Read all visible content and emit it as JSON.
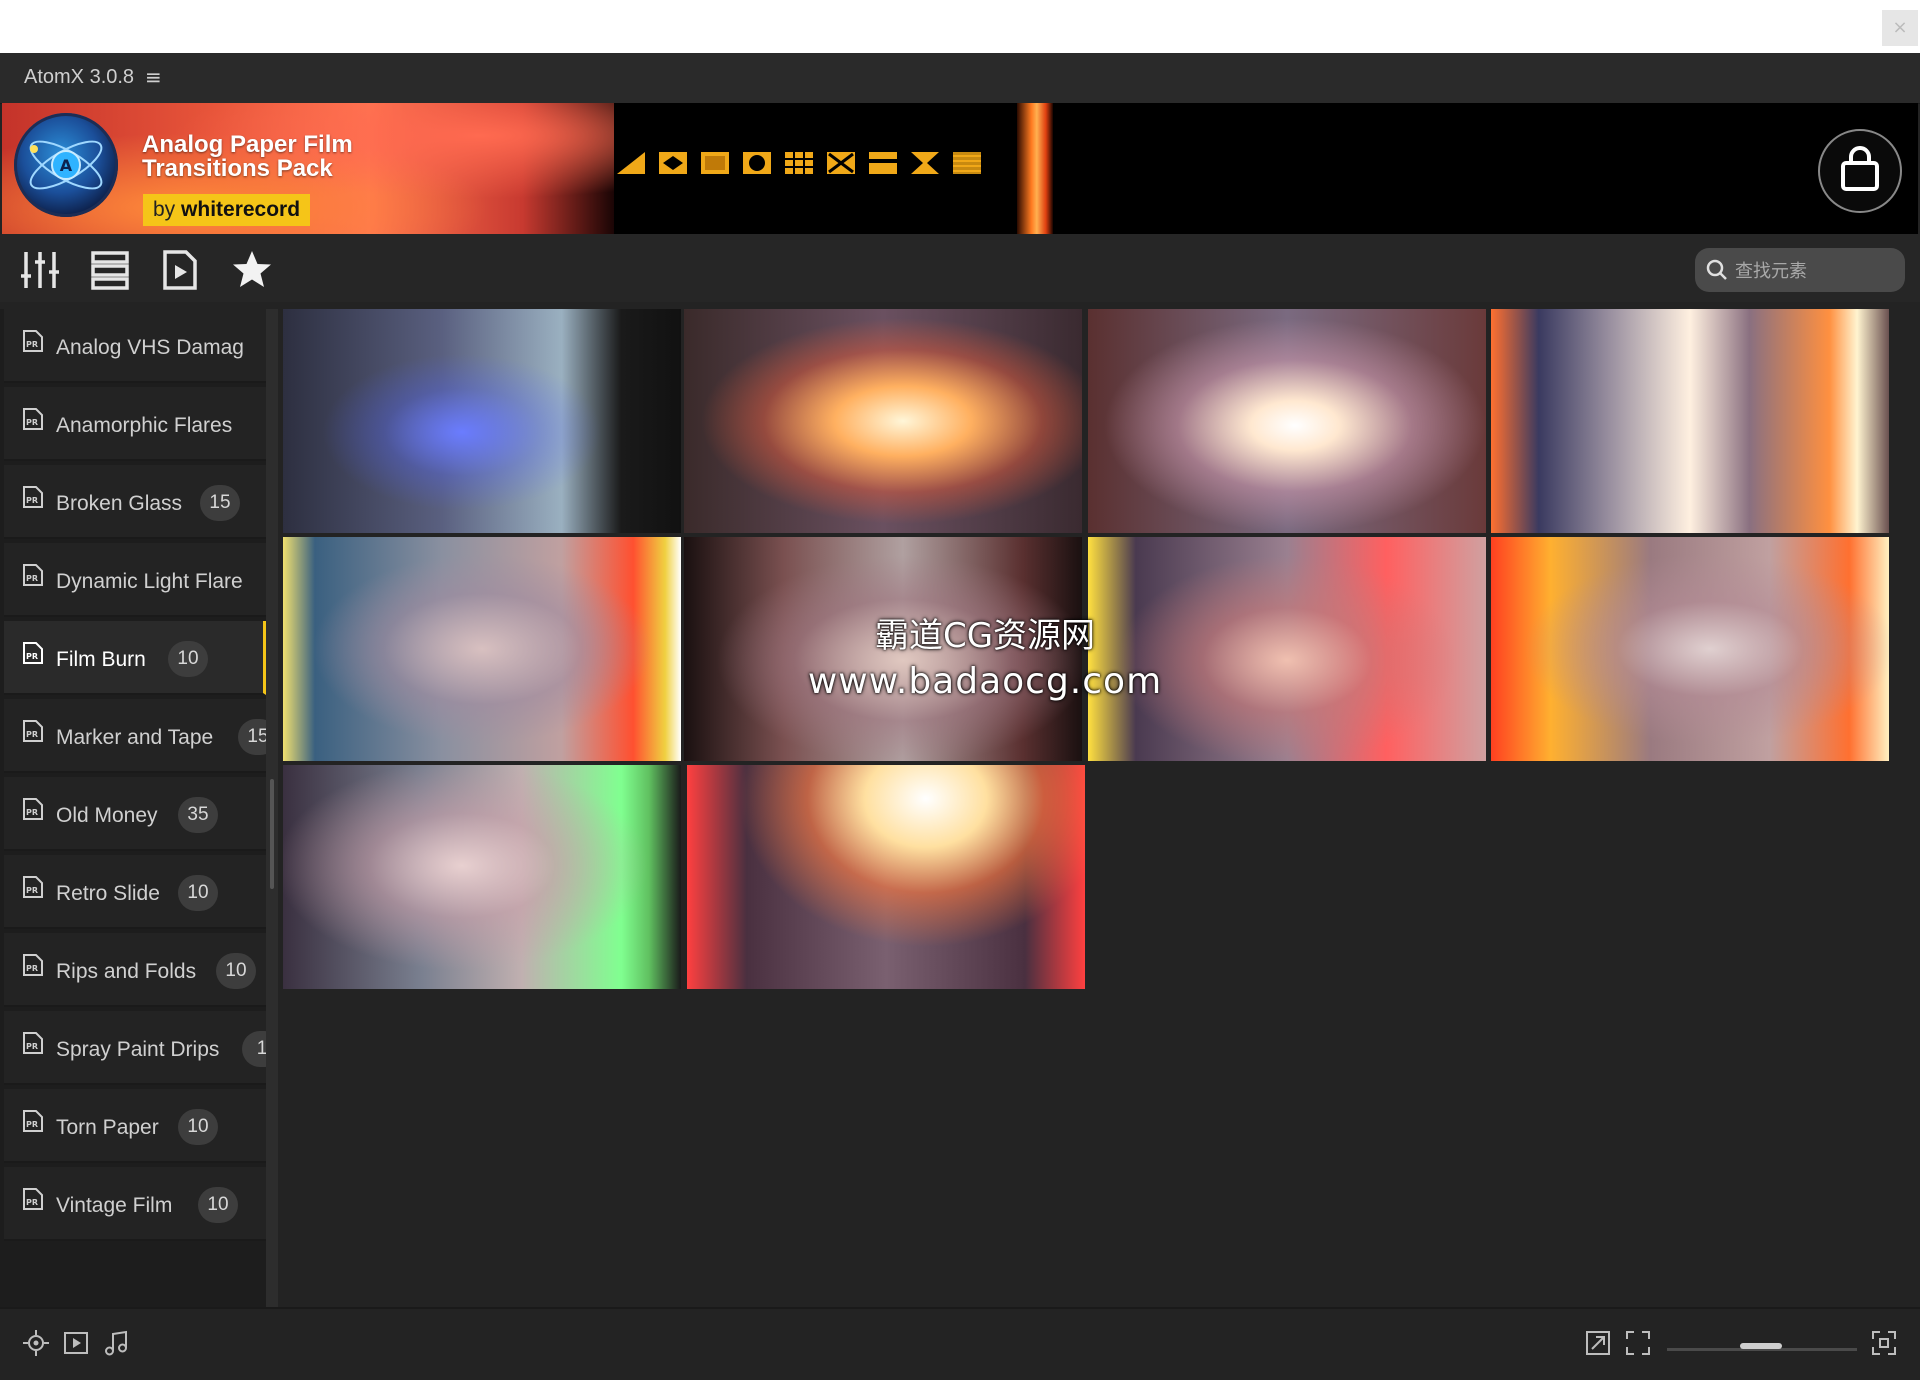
{
  "app": {
    "title": "AtomX 3.0.8",
    "menu_icon": "hamburger-icon"
  },
  "banner": {
    "title": "Analog Paper Film Transitions Pack",
    "author_prefix": "by",
    "author_name": "whiterecord",
    "accent": "#f5c518"
  },
  "toolbar": {
    "icons": [
      "sliders-icon",
      "list-icon",
      "media-file-icon",
      "star-icon"
    ],
    "search_placeholder": "查找元素"
  },
  "sidebar": {
    "items": [
      {
        "label": "Analog VHS Damag",
        "count": ""
      },
      {
        "label": "Anamorphic Flares",
        "count": ""
      },
      {
        "label": "Broken Glass",
        "count": "15"
      },
      {
        "label": "Dynamic Light Flare",
        "count": ""
      },
      {
        "label": "Film Burn",
        "count": "10",
        "active": true
      },
      {
        "label": "Marker and Tape",
        "count": "15"
      },
      {
        "label": "Old Money",
        "count": "35"
      },
      {
        "label": "Retro Slide",
        "count": "10"
      },
      {
        "label": "Rips and Folds",
        "count": "10"
      },
      {
        "label": "Spray Paint Drips",
        "count": "1"
      },
      {
        "label": "Torn Paper",
        "count": "10"
      },
      {
        "label": "Vintage Film",
        "count": "10"
      }
    ]
  },
  "grid": {
    "tile_count": 10
  },
  "watermark": {
    "line1": "霸道CG资源网",
    "line2": "www.badaocg.com"
  },
  "bottom": {
    "left_icons": [
      "capture-icon",
      "video-icon",
      "music-icon"
    ],
    "right_icons": [
      "resize-icon",
      "fullscreen-icon",
      "expand-icon"
    ],
    "zoom_level": 0.5
  }
}
